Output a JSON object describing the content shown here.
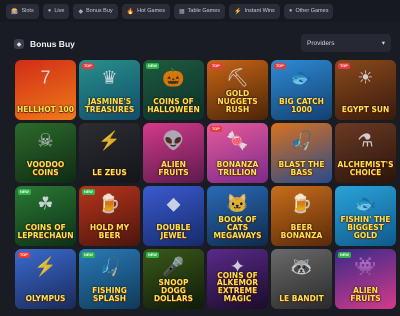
{
  "nav": {
    "items": [
      {
        "label": "Slots",
        "icon": "🎰"
      },
      {
        "label": "Live",
        "icon": "●"
      },
      {
        "label": "Bonus Buy",
        "icon": "◆"
      },
      {
        "label": "Hot Games",
        "icon": "🔥"
      },
      {
        "label": "Table Games",
        "icon": "▦"
      },
      {
        "label": "Instant Wins",
        "icon": "⚡"
      },
      {
        "label": "Other Games",
        "icon": "●"
      }
    ]
  },
  "section": {
    "title": "Bonus Buy",
    "icon": "◆"
  },
  "filter": {
    "providers_label": "Providers",
    "chevron": "▾"
  },
  "games": [
    {
      "name": "HELLHOT 100",
      "badge": "",
      "bg": [
        "#d12d16",
        "#f07a1a"
      ],
      "art": "7"
    },
    {
      "name": "JASMINE'S TREASURES",
      "badge": "TOP",
      "bg": [
        "#2a8f8a",
        "#0f4d6b"
      ],
      "art": "♛"
    },
    {
      "name": "COINS OF HALLOWEEN",
      "badge": "NEW",
      "bg": [
        "#1e5b3e",
        "#0d2f2b"
      ],
      "art": "🎃"
    },
    {
      "name": "GOLD NUGGETS RUSH",
      "badge": "TOP",
      "bg": [
        "#c86516",
        "#4a2508"
      ],
      "art": "⛏"
    },
    {
      "name": "BIG CATCH 1000",
      "badge": "TOP",
      "bg": [
        "#2d8bd6",
        "#14406f"
      ],
      "art": "🐟"
    },
    {
      "name": "EGYPT SUN",
      "badge": "TOP",
      "bg": [
        "#8a4a1c",
        "#3a1a0c"
      ],
      "art": "☀"
    },
    {
      "name": "VOODOO COINS",
      "badge": "",
      "bg": [
        "#2c6b2a",
        "#0f2a14"
      ],
      "art": "☠"
    },
    {
      "name": "LE ZEUS",
      "badge": "",
      "bg": [
        "#2c2d33",
        "#14151a"
      ],
      "art": "⚡"
    },
    {
      "name": "ALIEN FRUITS",
      "badge": "",
      "bg": [
        "#d33a8a",
        "#5b1a4d"
      ],
      "art": "👽"
    },
    {
      "name": "BONANZA TRILLION",
      "badge": "TOP",
      "bg": [
        "#e85a9a",
        "#7a2a8a"
      ],
      "art": "🍬"
    },
    {
      "name": "BLAST THE BASS",
      "badge": "",
      "bg": [
        "#d8721f",
        "#2a4a8a"
      ],
      "art": "🎣"
    },
    {
      "name": "ALCHEMIST'S CHOICE",
      "badge": "",
      "bg": [
        "#6b3a24",
        "#2a140c"
      ],
      "art": "⚗"
    },
    {
      "name": "COINS OF LEPRECHAUN",
      "badge": "NEW",
      "bg": [
        "#2b7a35",
        "#0c3016"
      ],
      "art": "☘"
    },
    {
      "name": "HOLD MY BEER",
      "badge": "NEW",
      "bg": [
        "#b8341c",
        "#4a160c"
      ],
      "art": "🍺"
    },
    {
      "name": "DOUBLE JEWEL",
      "badge": "",
      "bg": [
        "#3a5bd0",
        "#162a6b"
      ],
      "art": "◆"
    },
    {
      "name": "BOOK OF CATS MEGAWAYS",
      "badge": "",
      "bg": [
        "#2a6bb8",
        "#0f2a4a"
      ],
      "art": "🐱"
    },
    {
      "name": "BEER BONANZA",
      "badge": "",
      "bg": [
        "#c86e1c",
        "#5a2a08"
      ],
      "art": "🍺"
    },
    {
      "name": "FISHIN' THE BIGGEST GOLD",
      "badge": "",
      "bg": [
        "#2aa3d8",
        "#0f5a8a"
      ],
      "art": "🐟"
    },
    {
      "name": "OLYMPUS",
      "badge": "TOP",
      "bg": [
        "#3a6bd0",
        "#1a2a5a"
      ],
      "art": "⚡"
    },
    {
      "name": "FISHING SPLASH",
      "badge": "NEW",
      "bg": [
        "#2a7ab8",
        "#0f3a5a"
      ],
      "art": "🎣"
    },
    {
      "name": "SNOOP DOGG DOLLARS",
      "badge": "NEW",
      "bg": [
        "#3a5a1a",
        "#101a08"
      ],
      "art": "🎤"
    },
    {
      "name": "COINS OF ALKEMOR EXTREME MAGIC",
      "badge": "",
      "bg": [
        "#5a2a8a",
        "#1a0c2a"
      ],
      "art": "✦"
    },
    {
      "name": "LE BANDIT",
      "badge": "",
      "bg": [
        "#6a6a6a",
        "#2a2a2a"
      ],
      "art": "🦝"
    },
    {
      "name": "ALIEN FRUITS",
      "badge": "NEW",
      "bg": [
        "#3a2a8a",
        "#d33a8a"
      ],
      "art": "👾"
    }
  ]
}
